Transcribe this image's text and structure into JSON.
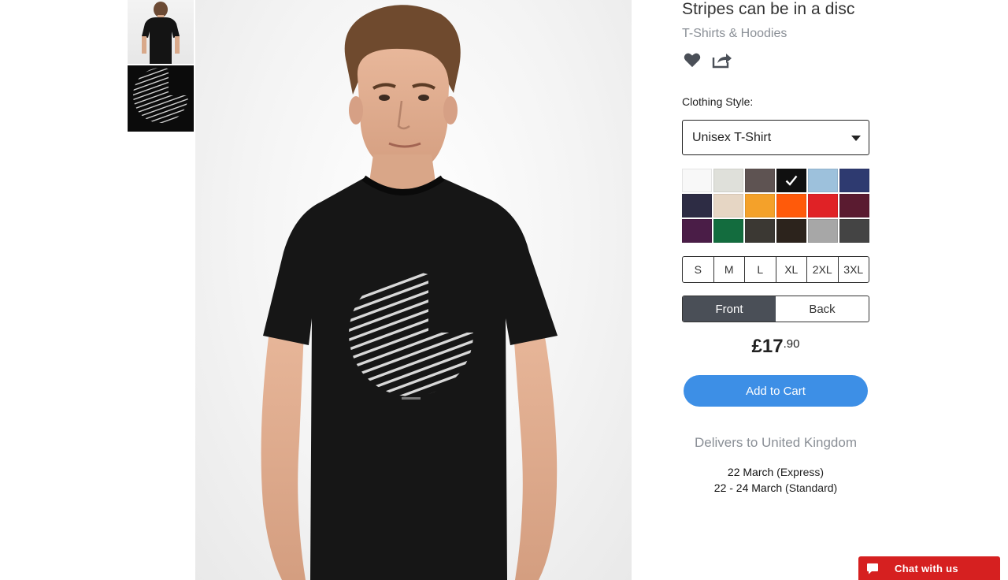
{
  "product": {
    "title": "Stripes can be in a disc",
    "category": "T-Shirts & Hoodies",
    "icons": [
      "heart-icon",
      "share-icon"
    ]
  },
  "gallery": {
    "thumbnails": [
      "back-view",
      "design-view"
    ],
    "main_view": "front"
  },
  "options": {
    "style_label": "Clothing Style:",
    "style_selected": "Unisex T-Shirt",
    "colors": [
      "#f8f8f8",
      "#dfe0da",
      "#5e5352",
      "#101010",
      "#9dc1dc",
      "#2e3a70",
      "#2d2c44",
      "#e6d6c4",
      "#f4a12a",
      "#ff5a0a",
      "#e02226",
      "#5a1b30",
      "#4a1d47",
      "#136c3e",
      "#3b3833",
      "#2c231c",
      "#a7a7a7",
      "#444444"
    ],
    "selected_color_index": 3,
    "sizes": [
      "S",
      "M",
      "L",
      "XL",
      "2XL",
      "3XL"
    ],
    "views": {
      "front": "Front",
      "back": "Back",
      "active": "front"
    }
  },
  "price": {
    "main": "£17",
    "cents": ".90"
  },
  "cart": {
    "label": "Add to Cart"
  },
  "delivery": {
    "heading": "Delivers to United Kingdom",
    "express_date": "22 March",
    "express_label": " (Express)",
    "standard_date": "22 - 24 March",
    "standard_label": " (Standard)"
  },
  "chat": {
    "label": "Chat with us"
  }
}
